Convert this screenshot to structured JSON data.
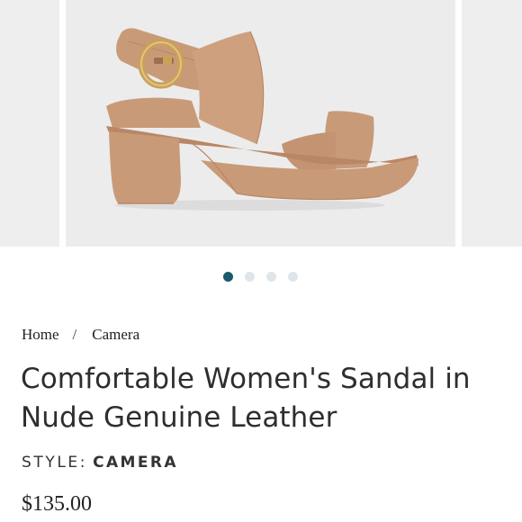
{
  "gallery": {
    "image_alt": "Nude leather block-heel platform sandal with gold buckle",
    "zoom_icon": "magnifier-icon",
    "dots_total": 4,
    "active_dot": 1
  },
  "breadcrumb": {
    "home_label": "Home",
    "separator": "/",
    "current_label": "Camera"
  },
  "product": {
    "title": "Comfortable Women's Sandal in Nude Genuine Leather",
    "style_label": "STYLE:",
    "style_value": "CAMERA",
    "price": "$135.00"
  },
  "colors": {
    "active_dot": "#1a5a6b",
    "inactive_dot": "#dfe6ea",
    "leather": "#c99a78",
    "buckle": "#c9a15a",
    "background_gray": "#ececec"
  }
}
